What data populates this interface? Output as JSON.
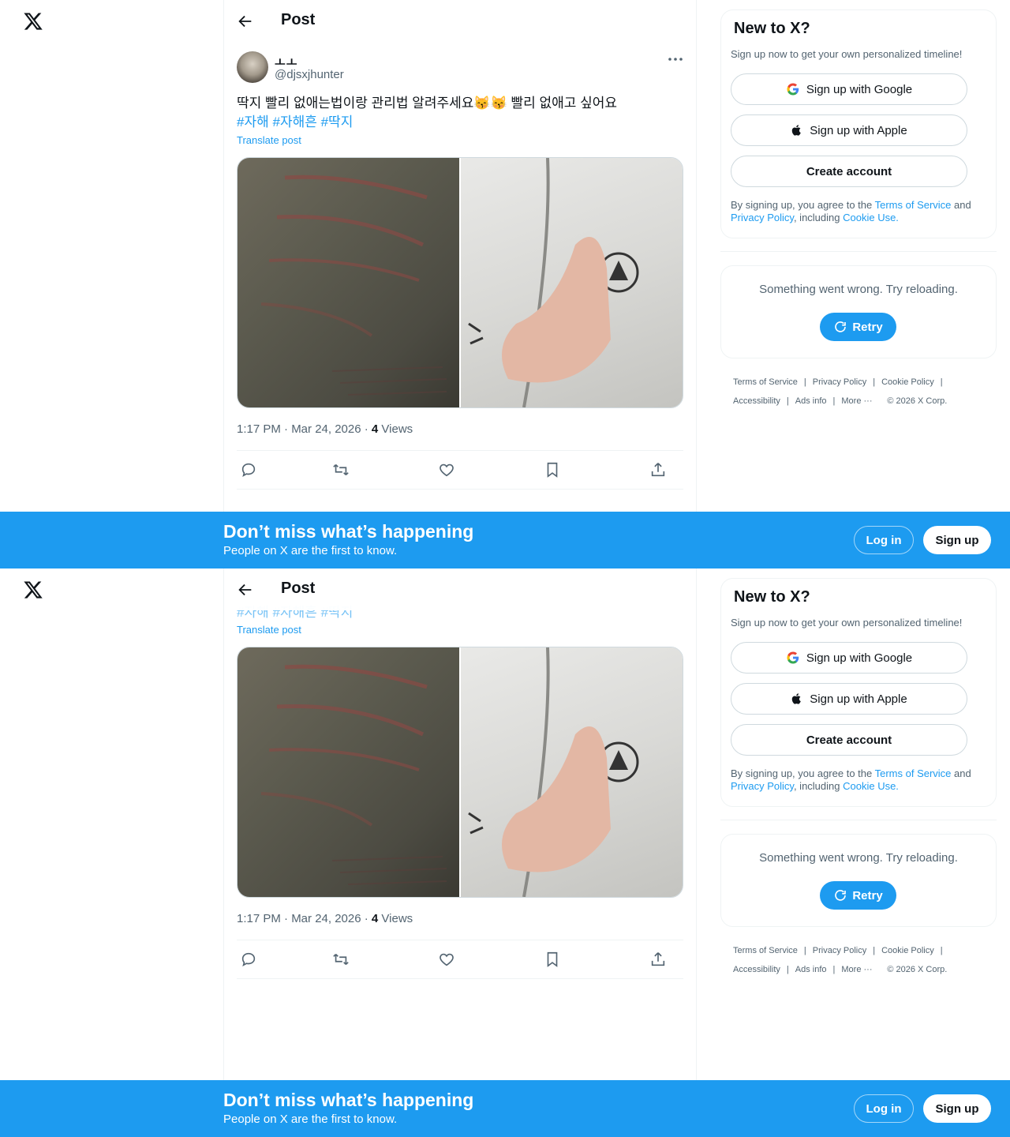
{
  "header": {
    "title": "Post"
  },
  "tweet": {
    "name": "ㅗㅗ",
    "handle": "@djsxjhunter",
    "text": "딱지 빨리 없애는법이랑 관리법 알려주세요😽😽 빨리 없애고 싶어요",
    "hashtags": [
      "#자해",
      "#자해흔",
      "#딱지"
    ],
    "translate": "Translate post",
    "time": "1:17 PM · Mar 24, 2026 · ",
    "views_count": "4",
    "views_label": " Views"
  },
  "sidebar": {
    "new_title": "New to X?",
    "new_sub": "Sign up now to get your own personalized timeline!",
    "google_label": "Sign up with Google",
    "apple_label": "Sign up with Apple",
    "create_label": "Create account",
    "legal_prefix": "By signing up, you agree to the ",
    "tos": "Terms of Service",
    "and": " and ",
    "privacy": "Privacy Policy",
    "including": ", including ",
    "cookie": "Cookie Use.",
    "error": "Something went wrong. Try reloading.",
    "retry": "Retry"
  },
  "footer": {
    "links": [
      "Terms of Service",
      "Privacy Policy",
      "Cookie Policy",
      "Accessibility",
      "Ads info",
      "More ···",
      "© 2026 X Corp."
    ]
  },
  "banner": {
    "title": "Don’t miss what’s happening",
    "subtitle": "People on X are the first to know.",
    "login": "Log in",
    "signup": "Sign up"
  },
  "colors": {
    "accent": "#1d9bf0",
    "text": "#0f1419",
    "muted": "#536471",
    "border": "#eff3f4"
  }
}
